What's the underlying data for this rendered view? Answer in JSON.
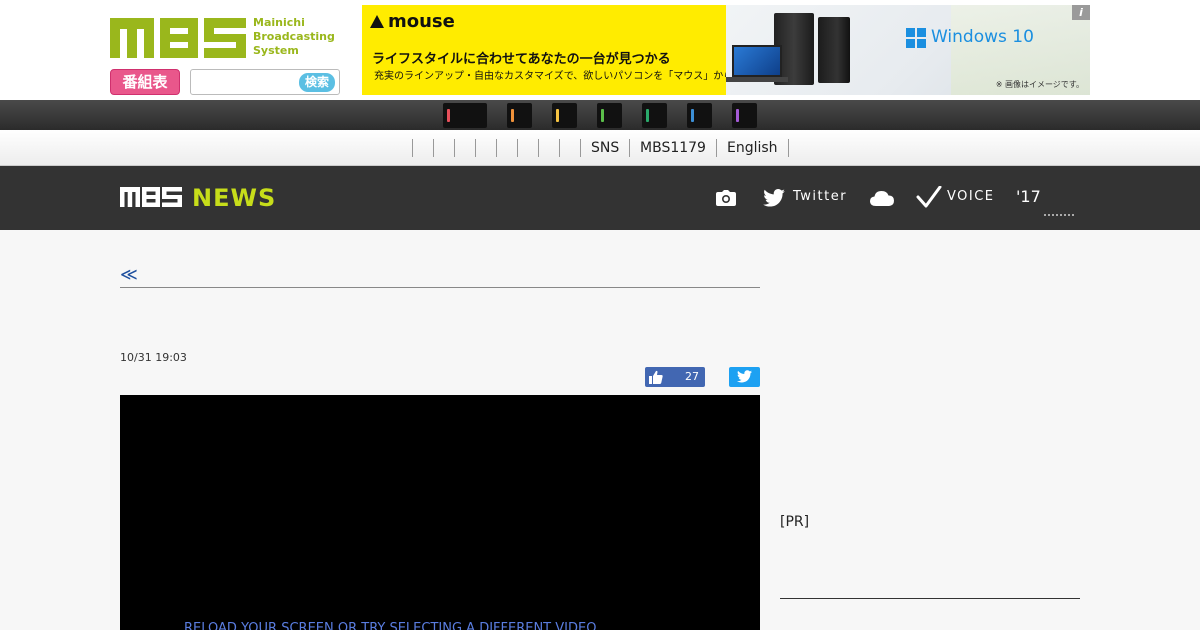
{
  "header": {
    "logo_lines": [
      "Mainichi",
      "Broadcasting",
      "System"
    ],
    "program_button": "番組表",
    "search": {
      "value": "",
      "placeholder": "",
      "button_label": "検索"
    }
  },
  "ad": {
    "brand": "mouse",
    "headline": "ライフスタイルに合わせてあなたの一台が見つかる",
    "subline": "充実のラインアップ・自由なカスタマイズで、欲しいパソコンを「マウス」から",
    "windows_label": "Windows 10",
    "note": "※ 画像はイメージです。",
    "info_label": "i"
  },
  "channels": [
    {
      "color": "#e8505b"
    },
    {
      "color": "#f0923a"
    },
    {
      "color": "#f6c342"
    },
    {
      "color": "#5bbf4a"
    },
    {
      "color": "#2aa96b"
    },
    {
      "color": "#3c8fd6"
    },
    {
      "color": "#a45ad6"
    }
  ],
  "sub_nav": {
    "items": [
      "SNS",
      "MBS1179",
      "English"
    ]
  },
  "news_header": {
    "logo_mbs": "MBS",
    "logo_news": "NEWS",
    "twitter_label": "Twitter",
    "voice_label": "VOICE",
    "year_label": "'17"
  },
  "article": {
    "back_link": "≪",
    "title": "",
    "date": "10/31 19:03",
    "like_count": "27",
    "video_error": "",
    "video_reload": "RELOAD YOUR SCREEN OR TRY SELECTING A DIFFERENT VIDEO"
  },
  "sidebar": {
    "pr_label": "[PR]",
    "heading": ""
  },
  "colors": {
    "brand_green": "#9ab71c",
    "news_green": "#c7dd1a",
    "program_pink": "#e9578b",
    "search_blue": "#5bbfe3",
    "link_blue": "#1d4f9e",
    "facebook_blue": "#4267b2",
    "twitter_blue": "#1da1f2"
  }
}
